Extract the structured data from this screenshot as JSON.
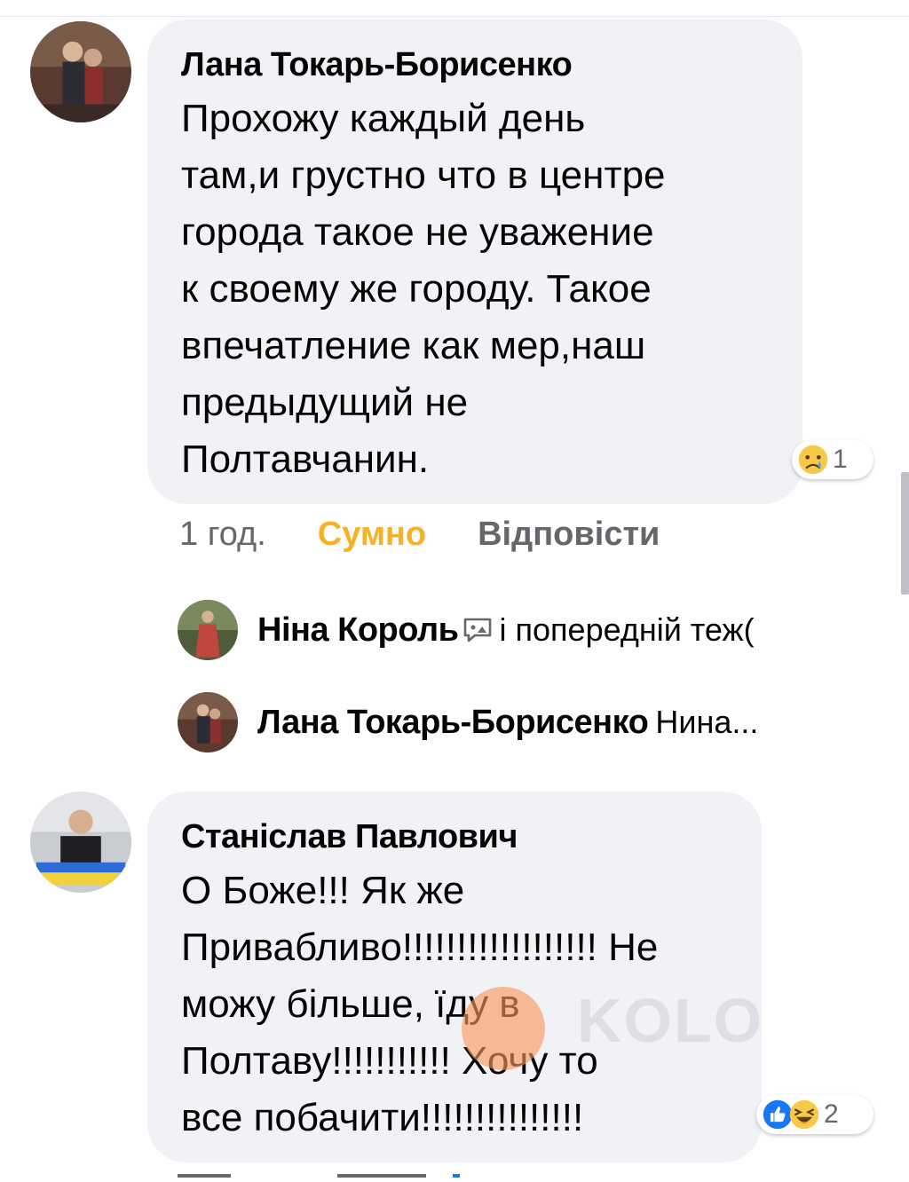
{
  "comments": [
    {
      "author": "Лана Токарь-Борисенко",
      "lines": [
        "Прохожу каждый день",
        "там,и грустно что в центре",
        "города такое не уважение",
        "к своему же городу. Такое",
        "впечатление как мер,наш",
        "предыдущий не",
        "Полтавчанин."
      ],
      "reaction_count": "1",
      "reaction_icon": "sad-emoji",
      "time": "1 год.",
      "my_reaction": "Сумно",
      "reply_label": "Відповісти",
      "replies": [
        {
          "name": "Ніна Король",
          "text": "і попередній теж(",
          "icon": "sticker-icon"
        },
        {
          "name": "Лана Токарь-Борисенко",
          "text": "Нина..."
        }
      ]
    },
    {
      "author": "Станіслав Павлович",
      "lines": [
        "О Боже!!! Як же",
        "Привабливо!!!!!!!!!!!!!!!!!! Не",
        "можу більше, їду в",
        "Полтаву!!!!!!!!!!! Хочу то",
        "все побачити!!!!!!!!!!!!!!!"
      ],
      "reaction_count": "2",
      "reaction_icons": [
        "like-icon",
        "haha-emoji"
      ]
    }
  ],
  "colors": {
    "bubble": "#f0f2f5",
    "sad_accent": "#f7b125",
    "muted": "#65676b",
    "like_blue": "#1877f2"
  }
}
